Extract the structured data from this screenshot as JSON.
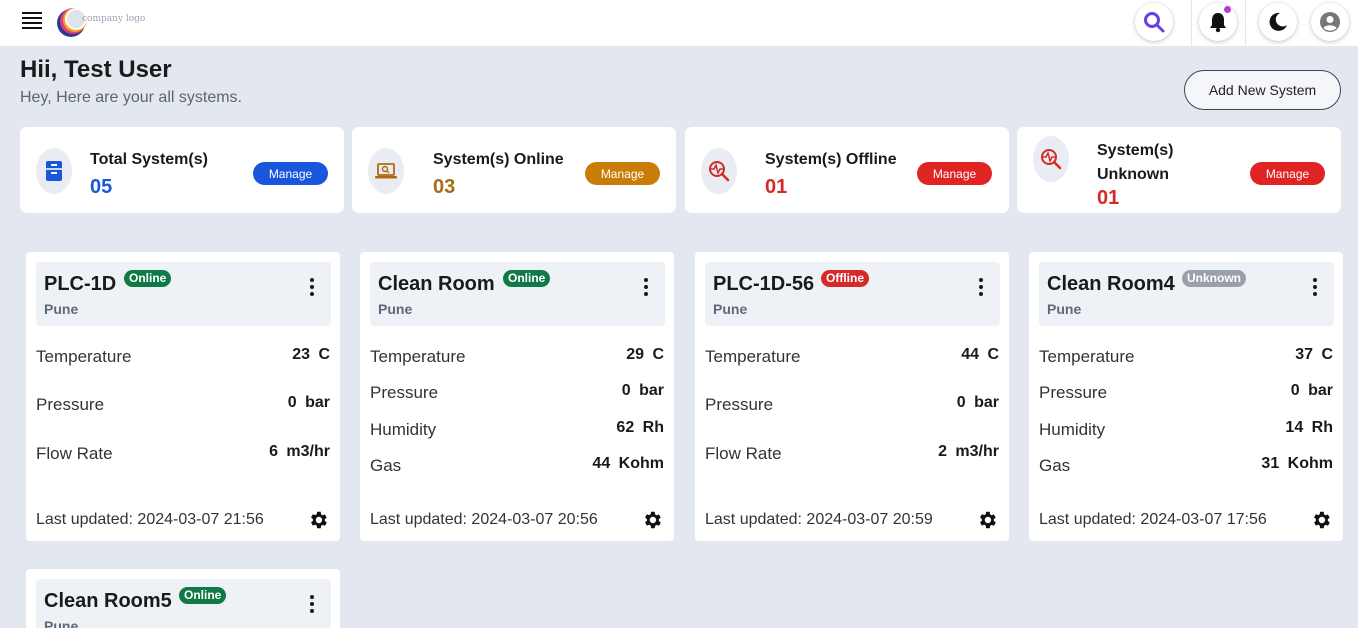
{
  "header": {
    "logo_text": "company logo",
    "greeting": "Hii, Test User",
    "subgreeting": "Hey, Here are your all systems.",
    "add_button": "Add New System"
  },
  "colors": {
    "primary_blue": "#1a56db",
    "online_amber": "#c97d06",
    "offline_red": "#d42a2a",
    "badge_online": "#0f7a45",
    "badge_offline": "#d42a2a",
    "badge_unknown": "#9aa0aa",
    "search_purple": "#6b3fe0"
  },
  "stats": [
    {
      "title": "Total System(s)",
      "count": "05",
      "manage": "Manage",
      "icon": "cabinet-icon"
    },
    {
      "title": "System(s) Online",
      "count": "03",
      "manage": "Manage",
      "icon": "laptop-search-icon"
    },
    {
      "title": "System(s) Offline",
      "count": "01",
      "manage": "Manage",
      "icon": "pulse-search-icon"
    },
    {
      "title": "System(s) Unknown",
      "count": "01",
      "manage": "Manage",
      "icon": "pulse-search-icon"
    }
  ],
  "systems": [
    {
      "name": "PLC-1D",
      "status": "Online",
      "location": "Pune",
      "metrics": [
        {
          "label": "Temperature",
          "value": "23 C"
        },
        {
          "label": "Pressure",
          "value": "0 bar"
        },
        {
          "label": "Flow Rate",
          "value": "6 m3/hr"
        }
      ],
      "updated": "Last updated: 2024-03-07 21:56"
    },
    {
      "name": "Clean Room",
      "status": "Online",
      "location": "Pune",
      "metrics": [
        {
          "label": "Temperature",
          "value": "29 C"
        },
        {
          "label": "Pressure",
          "value": "0 bar"
        },
        {
          "label": "Humidity",
          "value": "62 Rh"
        },
        {
          "label": "Gas",
          "value": "44 Kohm"
        }
      ],
      "updated": "Last updated: 2024-03-07 20:56"
    },
    {
      "name": "PLC-1D-56",
      "status": "Offline",
      "location": "Pune",
      "metrics": [
        {
          "label": "Temperature",
          "value": "44 C"
        },
        {
          "label": "Pressure",
          "value": "0 bar"
        },
        {
          "label": "Flow Rate",
          "value": "2 m3/hr"
        }
      ],
      "updated": "Last updated: 2024-03-07 20:59"
    },
    {
      "name": "Clean Room4",
      "status": "Unknown",
      "location": "Pune",
      "metrics": [
        {
          "label": "Temperature",
          "value": "37 C"
        },
        {
          "label": "Pressure",
          "value": "0 bar"
        },
        {
          "label": "Humidity",
          "value": "14 Rh"
        },
        {
          "label": "Gas",
          "value": "31 Kohm"
        }
      ],
      "updated": "Last updated: 2024-03-07 17:56"
    },
    {
      "name": "Clean Room5",
      "status": "Online",
      "location": "Pune"
    }
  ]
}
